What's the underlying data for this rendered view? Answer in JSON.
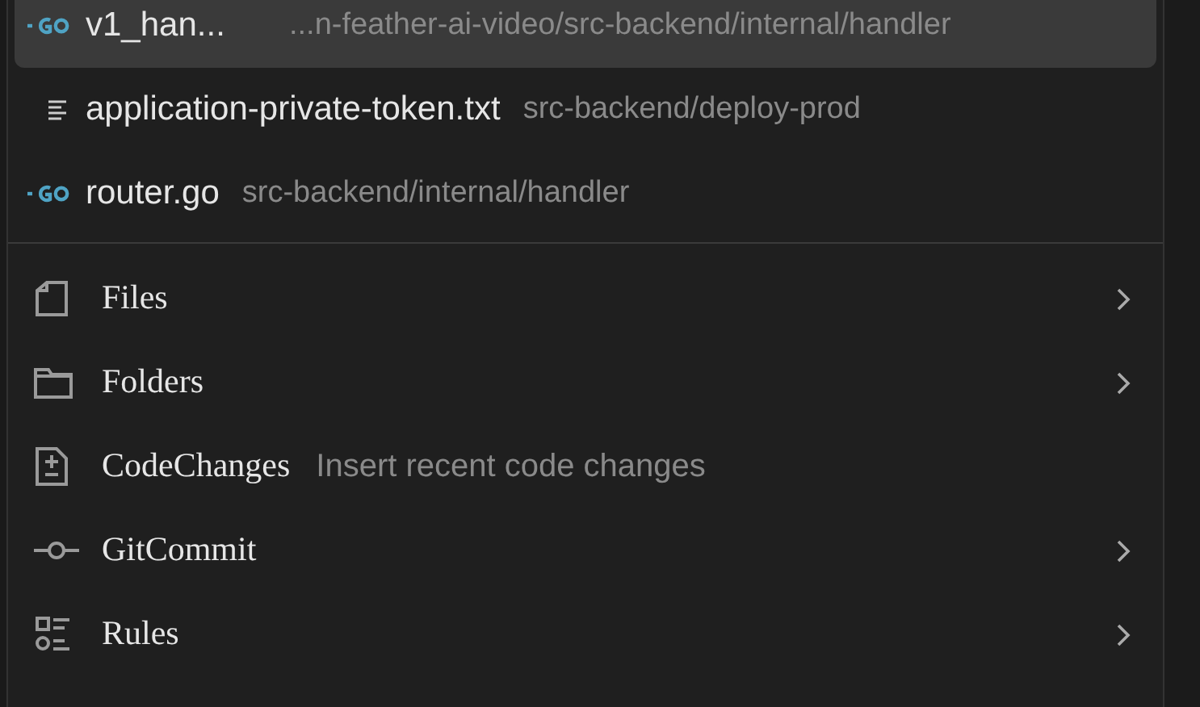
{
  "recent_files": [
    {
      "kind": "go",
      "name": "v1_han...",
      "path": "...n-feather-ai-video/src-backend/internal/handler",
      "selected": true
    },
    {
      "kind": "text",
      "name": "application-private-token.txt",
      "path": "src-backend/deploy-prod",
      "selected": false
    },
    {
      "kind": "go",
      "name": "router.go",
      "path": "src-backend/internal/handler",
      "selected": false
    }
  ],
  "menu_items": [
    {
      "kind": "file",
      "label": "Files",
      "has_submenu": true
    },
    {
      "kind": "folder",
      "label": "Folders",
      "has_submenu": true
    },
    {
      "kind": "diff",
      "label": "CodeChanges",
      "description": "Insert recent code changes",
      "has_submenu": false
    },
    {
      "kind": "commit",
      "label": "GitCommit",
      "has_submenu": true
    },
    {
      "kind": "rules",
      "label": "Rules",
      "has_submenu": true
    }
  ]
}
